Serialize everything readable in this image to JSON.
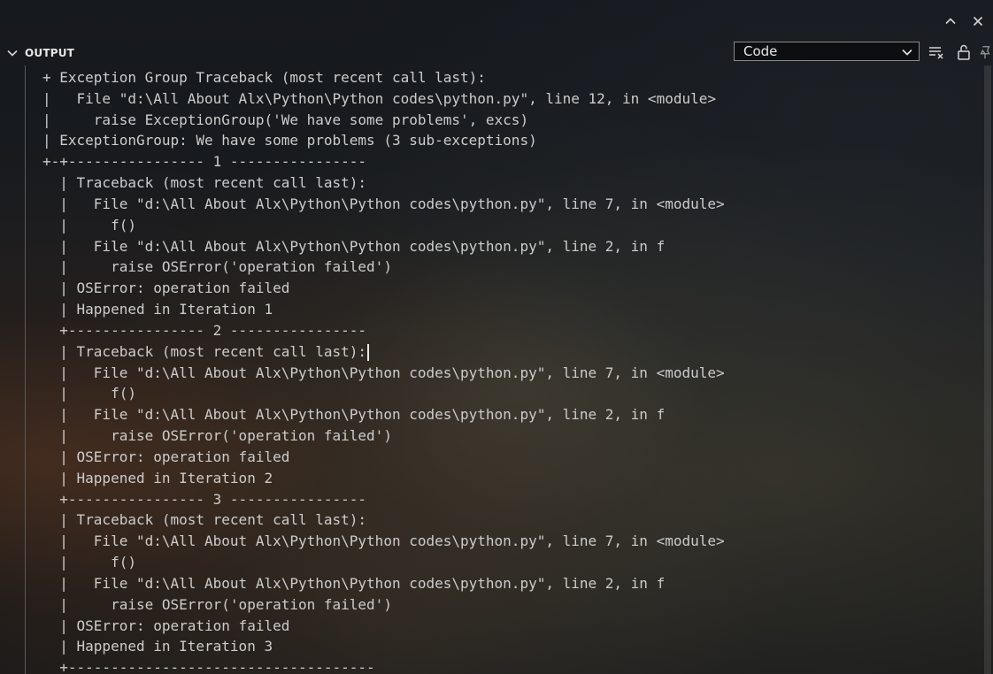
{
  "panel": {
    "title": "OUTPUT",
    "channel_select": {
      "value": "Code"
    },
    "icons": {
      "collapse": "chevron-down-icon",
      "maximize": "chevron-up-icon",
      "close": "close-icon",
      "clear": "clear-output-icon",
      "lock": "unlock-scroll-icon",
      "pin": "pin-icon"
    }
  },
  "output": {
    "lines": [
      "+ Exception Group Traceback (most recent call last):",
      "|   File \"d:\\All About Alx\\Python\\Python codes\\python.py\", line 12, in <module>",
      "|     raise ExceptionGroup('We have some problems', excs)",
      "| ExceptionGroup: We have some problems (3 sub-exceptions)",
      "+-+---------------- 1 ----------------",
      "  | Traceback (most recent call last):",
      "  |   File \"d:\\All About Alx\\Python\\Python codes\\python.py\", line 7, in <module>",
      "  |     f()",
      "  |   File \"d:\\All About Alx\\Python\\Python codes\\python.py\", line 2, in f",
      "  |     raise OSError('operation failed')",
      "  | OSError: operation failed",
      "  | Happened in Iteration 1",
      "  +---------------- 2 ----------------",
      "  | Traceback (most recent call last):",
      "  |   File \"d:\\All About Alx\\Python\\Python codes\\python.py\", line 7, in <module>",
      "  |     f()",
      "  |   File \"d:\\All About Alx\\Python\\Python codes\\python.py\", line 2, in f",
      "  |     raise OSError('operation failed')",
      "  | OSError: operation failed",
      "  | Happened in Iteration 2",
      "  +---------------- 3 ----------------",
      "  | Traceback (most recent call last):",
      "  |   File \"d:\\All About Alx\\Python\\Python codes\\python.py\", line 7, in <module>",
      "  |     f()",
      "  |   File \"d:\\All About Alx\\Python\\Python codes\\python.py\", line 2, in f",
      "  |     raise OSError('operation failed')",
      "  | OSError: operation failed",
      "  | Happened in Iteration 3",
      "  +------------------------------------"
    ]
  }
}
